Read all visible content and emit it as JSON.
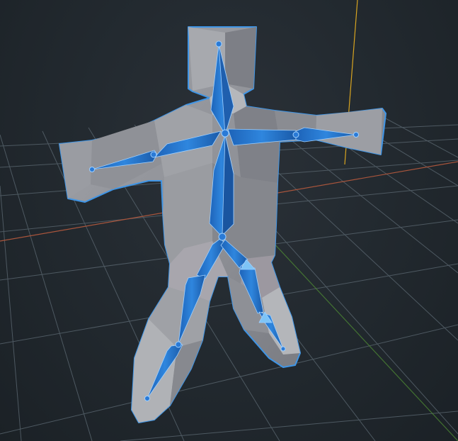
{
  "viewport": {
    "view": "perspective",
    "grid_visible": true,
    "colors": {
      "background": "#232a30",
      "grid_line": "#5a6670",
      "axis_x": "#b0553a",
      "axis_y": "#5a9a3a",
      "axis_z": "#d9a520",
      "mesh_fill": "#8a8c92",
      "mesh_outline": "#3f95e6",
      "bone_fill": "#2a7ad6",
      "bone_light": "#5fb0f0"
    }
  },
  "model": {
    "object": "character-mesh",
    "selected": true
  },
  "armature": {
    "selected": true,
    "bones": [
      "head-bone",
      "spine-upper-bone",
      "spine-lower-bone",
      "left-upper-arm-bone",
      "left-forearm-bone",
      "right-upper-arm-bone",
      "right-forearm-bone",
      "left-hip-bone",
      "left-thigh-bone",
      "left-shin-bone",
      "right-hip-bone",
      "right-thigh-bone",
      "right-shin-bone"
    ]
  }
}
